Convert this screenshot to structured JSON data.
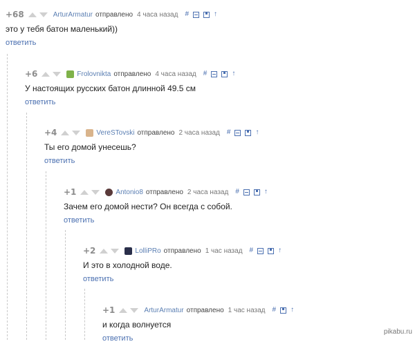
{
  "comments": [
    {
      "rating": "+68",
      "author": "ArturArmatur",
      "sent": "отправлено",
      "time": "4 часа назад",
      "text": "это у тебя батон маленький))",
      "reply": "ответить",
      "avatar": false,
      "avatar_color": ""
    },
    {
      "rating": "+6",
      "author": "Frolovnikta",
      "sent": "отправлено",
      "time": "4 часа назад",
      "text": "У настоящих русских батон длинной 49.5 см",
      "reply": "ответить",
      "avatar": true,
      "avatar_color": "#7fb24a"
    },
    {
      "rating": "+4",
      "author": "VereSTovski",
      "sent": "отправлено",
      "time": "2 часа назад",
      "text": "Ты его домой унесешь?",
      "reply": "ответить",
      "avatar": true,
      "avatar_color": "#d9b48c"
    },
    {
      "rating": "+1",
      "author": "Antonio8",
      "sent": "отправлено",
      "time": "2 часа назад",
      "text": "Зачем его домой нести? Он всегда с собой.",
      "reply": "ответить",
      "avatar": true,
      "avatar_color": "#5a3a3a"
    },
    {
      "rating": "+2",
      "author": "LolliPRo",
      "sent": "отправлено",
      "time": "1 час назад",
      "text": "И это в холодной воде.",
      "reply": "ответить",
      "avatar": true,
      "avatar_color": "#2a2f4a"
    },
    {
      "rating": "+1",
      "author": "ArturArmatur",
      "sent": "отправлено",
      "time": "1 час назад",
      "text": "и когда волнуется",
      "reply": "ответить",
      "avatar": false,
      "avatar_color": ""
    }
  ],
  "tools": {
    "hash": "#",
    "up_arrow": "↑",
    "minus_icon": "minus-box-icon",
    "save_icon": "save-icon"
  },
  "watermark": "pikabu.ru"
}
